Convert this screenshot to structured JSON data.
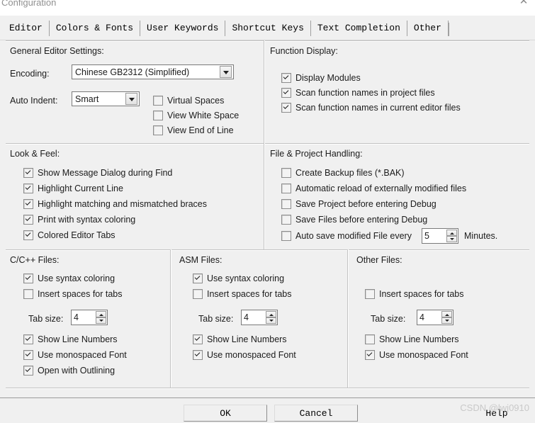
{
  "window": {
    "title": "Configuration",
    "close_icon": "✕"
  },
  "tabs": [
    {
      "label": "Editor",
      "active": true
    },
    {
      "label": "Colors & Fonts",
      "active": false
    },
    {
      "label": "User Keywords",
      "active": false
    },
    {
      "label": "Shortcut Keys",
      "active": false
    },
    {
      "label": "Text Completion",
      "active": false
    },
    {
      "label": "Other",
      "active": false
    }
  ],
  "general": {
    "title": "General Editor Settings:",
    "encoding_label": "Encoding:",
    "encoding_value": "Chinese GB2312 (Simplified)",
    "auto_indent_label": "Auto Indent:",
    "auto_indent_value": "Smart",
    "options": [
      {
        "label": "Virtual Spaces",
        "checked": false
      },
      {
        "label": "View White Space",
        "checked": false
      },
      {
        "label": "View End of Line",
        "checked": false
      }
    ]
  },
  "function_display": {
    "title": "Function Display:",
    "options": [
      {
        "label": "Display Modules",
        "checked": true
      },
      {
        "label": "Scan function names in project files",
        "checked": true
      },
      {
        "label": "Scan function names in current editor files",
        "checked": true
      }
    ]
  },
  "look_feel": {
    "title": "Look & Feel:",
    "options": [
      {
        "label": "Show Message Dialog during Find",
        "checked": true
      },
      {
        "label": "Highlight Current Line",
        "checked": true
      },
      {
        "label": "Highlight matching and mismatched braces",
        "checked": true
      },
      {
        "label": "Print with syntax coloring",
        "checked": true
      },
      {
        "label": "Colored Editor Tabs",
        "checked": true
      }
    ]
  },
  "file_project": {
    "title": "File & Project Handling:",
    "options": [
      {
        "label": "Create Backup files (*.BAK)",
        "checked": false
      },
      {
        "label": "Automatic reload of externally modified files",
        "checked": false
      },
      {
        "label": "Save Project before entering Debug",
        "checked": false
      },
      {
        "label": "Save Files before entering Debug",
        "checked": false
      },
      {
        "label": "Auto save modified File every",
        "checked": false
      }
    ],
    "autosave_minutes": "5",
    "minutes_label": "Minutes."
  },
  "cpp_files": {
    "title": "C/C++ Files:",
    "syntax": {
      "label": "Use syntax coloring",
      "checked": true
    },
    "spaces": {
      "label": "Insert spaces for tabs",
      "checked": false
    },
    "tab_size_label": "Tab size:",
    "tab_size_value": "4",
    "line_numbers": {
      "label": "Show Line Numbers",
      "checked": true
    },
    "monospaced": {
      "label": "Use monospaced Font",
      "checked": true
    },
    "outlining": {
      "label": "Open with Outlining",
      "checked": true
    }
  },
  "asm_files": {
    "title": "ASM Files:",
    "syntax": {
      "label": "Use syntax coloring",
      "checked": true
    },
    "spaces": {
      "label": "Insert spaces for tabs",
      "checked": false
    },
    "tab_size_label": "Tab size:",
    "tab_size_value": "4",
    "line_numbers": {
      "label": "Show Line Numbers",
      "checked": true
    },
    "monospaced": {
      "label": "Use monospaced Font",
      "checked": true
    }
  },
  "other_files": {
    "title": "Other Files:",
    "spaces": {
      "label": "Insert spaces for tabs",
      "checked": false
    },
    "tab_size_label": "Tab size:",
    "tab_size_value": "4",
    "line_numbers": {
      "label": "Show Line Numbers",
      "checked": false
    },
    "monospaced": {
      "label": "Use monospaced Font",
      "checked": true
    }
  },
  "footer": {
    "ok": "OK",
    "cancel": "Cancel",
    "help": "Help"
  },
  "watermark": "CSDN @lwj0910"
}
